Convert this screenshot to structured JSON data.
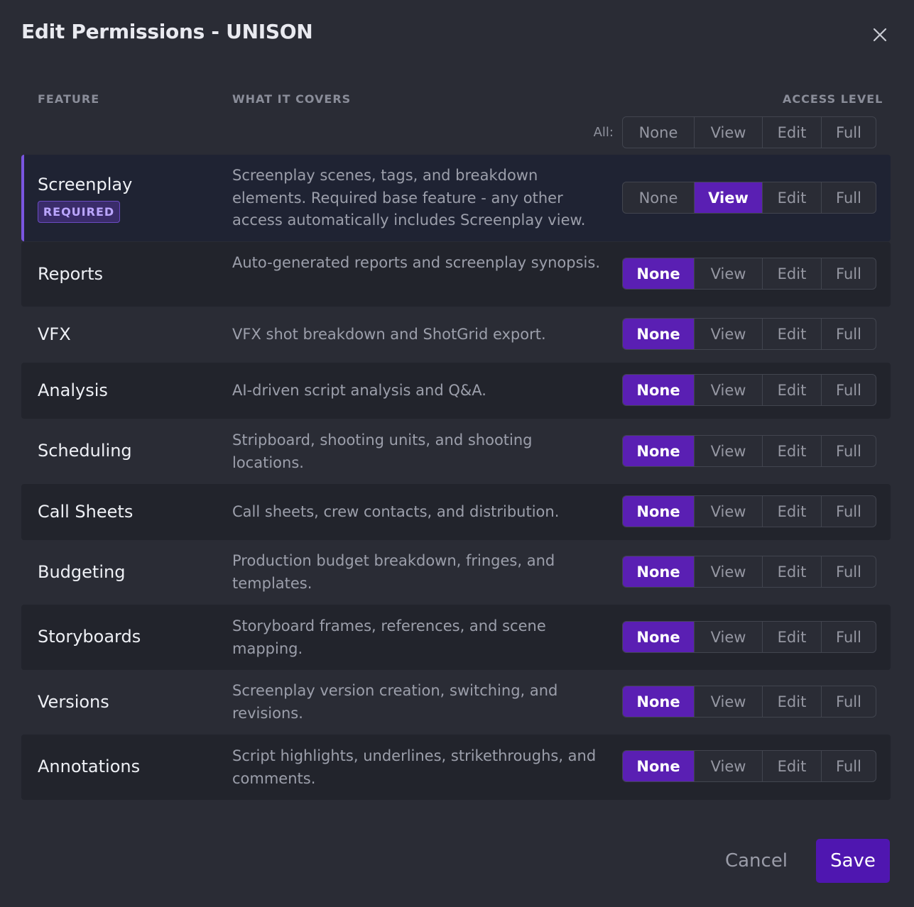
{
  "dialog": {
    "title": "Edit Permissions - UNISON",
    "close_icon": "close-icon"
  },
  "headers": {
    "feature": "FEATURE",
    "covers": "WHAT IT COVERS",
    "access": "ACCESS LEVEL",
    "all_label": "All:"
  },
  "access_options": [
    "None",
    "View",
    "Edit",
    "Full"
  ],
  "features": [
    {
      "name": "Screenplay",
      "badge": "REQUIRED",
      "desc": "Screenplay scenes, tags, and breakdown elements. Required base feature - any other access automatically includes Screenplay view.",
      "selected": "View"
    },
    {
      "name": "Reports",
      "desc": "Auto-generated reports and screenplay synopsis.",
      "selected": "None"
    },
    {
      "name": "VFX",
      "desc": "VFX shot breakdown and ShotGrid export.",
      "selected": "None"
    },
    {
      "name": "Analysis",
      "desc": "AI-driven script analysis and Q&A.",
      "selected": "None"
    },
    {
      "name": "Scheduling",
      "desc": "Stripboard, shooting units, and shooting locations.",
      "selected": "None"
    },
    {
      "name": "Call Sheets",
      "desc": "Call sheets, crew contacts, and distribution.",
      "selected": "None"
    },
    {
      "name": "Budgeting",
      "desc": "Production budget breakdown, fringes, and templates.",
      "selected": "None"
    },
    {
      "name": "Storyboards",
      "desc": "Storyboard frames, references, and scene mapping.",
      "selected": "None"
    },
    {
      "name": "Versions",
      "desc": "Screenplay version creation, switching, and revisions.",
      "selected": "None"
    },
    {
      "name": "Annotations",
      "desc": "Script highlights, underlines, strikethroughs, and comments.",
      "selected": "None"
    }
  ],
  "footer": {
    "cancel_label": "Cancel",
    "save_label": "Save"
  },
  "colors": {
    "background": "#2a2c35",
    "accent": "#5a1fb3",
    "save": "#4f16b0"
  }
}
